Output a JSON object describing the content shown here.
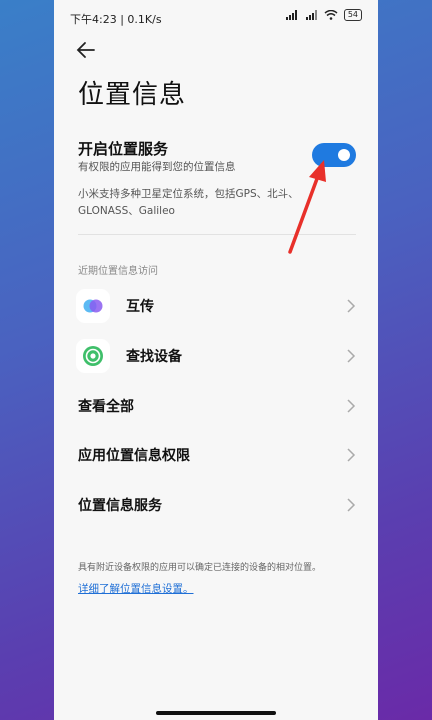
{
  "status_bar": {
    "time": "下午4:23 | 0.1K/s",
    "battery": "54"
  },
  "page": {
    "title": "位置信息"
  },
  "location_service": {
    "title": "开启位置服务",
    "subtitle": "有权限的应用能得到您的位置信息",
    "toggle_on": true,
    "gps_note": "小米支持多种卫星定位系统，包括GPS、北斗、GLONASS、Galileo"
  },
  "recent_access": {
    "label": "近期位置信息访问",
    "apps": [
      {
        "name": "互传",
        "icon": "mi-share-icon"
      },
      {
        "name": "查找设备",
        "icon": "find-device-icon"
      }
    ]
  },
  "menu": {
    "view_all": "查看全部",
    "app_permissions": "应用位置信息权限",
    "location_services": "位置信息服务"
  },
  "footer": {
    "note": "具有附近设备权限的应用可以确定已连接的设备的相对位置。",
    "link": "详细了解位置信息设置。"
  },
  "colors": {
    "accent": "#1f7ae0",
    "annotation_arrow": "#e8302a"
  }
}
